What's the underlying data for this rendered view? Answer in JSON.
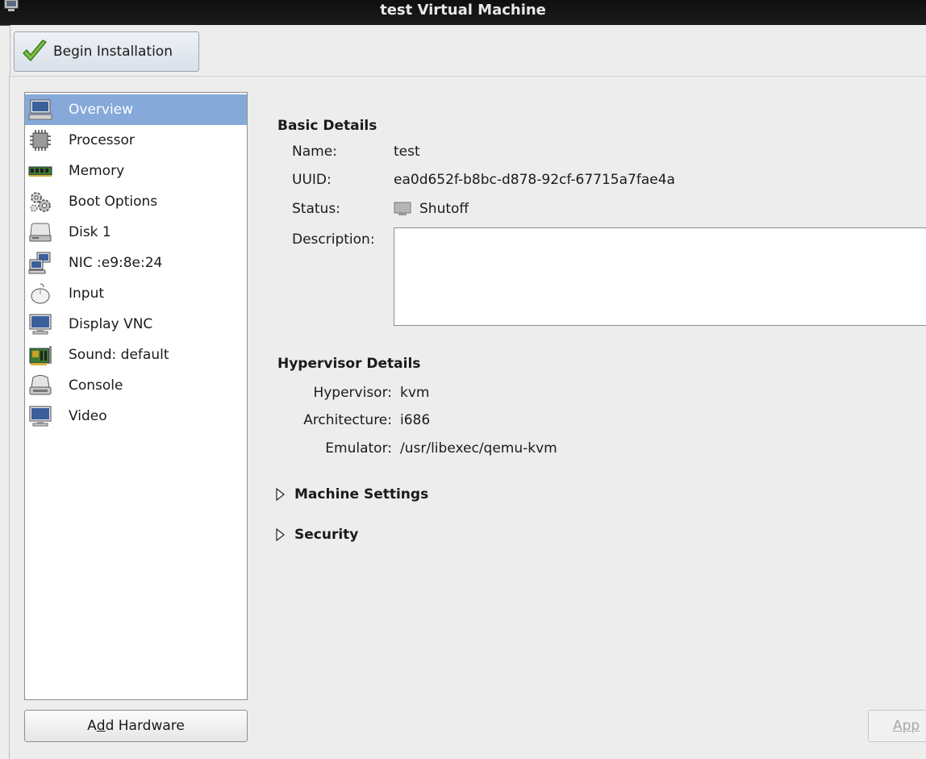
{
  "window": {
    "title": "test Virtual Machine"
  },
  "toolbar": {
    "begin_installation_label": "Begin Installation"
  },
  "sidebar": {
    "items": [
      {
        "label": "Overview",
        "icon": "monitor-icon",
        "selected": true
      },
      {
        "label": "Processor",
        "icon": "cpu-chip-icon"
      },
      {
        "label": "Memory",
        "icon": "memory-module-icon"
      },
      {
        "label": "Boot Options",
        "icon": "gears-icon"
      },
      {
        "label": "Disk 1",
        "icon": "hard-disk-icon"
      },
      {
        "label": "NIC :e9:8e:24",
        "icon": "network-icon"
      },
      {
        "label": "Input",
        "icon": "mouse-icon"
      },
      {
        "label": "Display VNC",
        "icon": "display-icon"
      },
      {
        "label": "Sound: default",
        "icon": "sound-card-icon"
      },
      {
        "label": "Console",
        "icon": "console-icon"
      },
      {
        "label": "Video",
        "icon": "video-icon"
      }
    ],
    "add_hardware_label_pre": "A",
    "add_hardware_label_mnemonic": "d",
    "add_hardware_label_post": "d Hardware"
  },
  "basic_details": {
    "heading": "Basic Details",
    "name_label": "Name:",
    "name_value": "test",
    "uuid_label": "UUID:",
    "uuid_value": "ea0d652f-b8bc-d878-92cf-67715a7fae4a",
    "status_label": "Status:",
    "status_value": "Shutoff",
    "description_label": "Description:",
    "description_value": ""
  },
  "hypervisor_details": {
    "heading": "Hypervisor Details",
    "hypervisor_label": "Hypervisor:",
    "hypervisor_value": "kvm",
    "architecture_label": "Architecture:",
    "architecture_value": "i686",
    "emulator_label": "Emulator:",
    "emulator_value": "/usr/libexec/qemu-kvm"
  },
  "expanders": {
    "machine_settings": "Machine Settings",
    "security": "Security"
  },
  "footer": {
    "apply_label": "App"
  },
  "colors": {
    "selection": "#86a9d9",
    "titlebar": "#141414"
  }
}
